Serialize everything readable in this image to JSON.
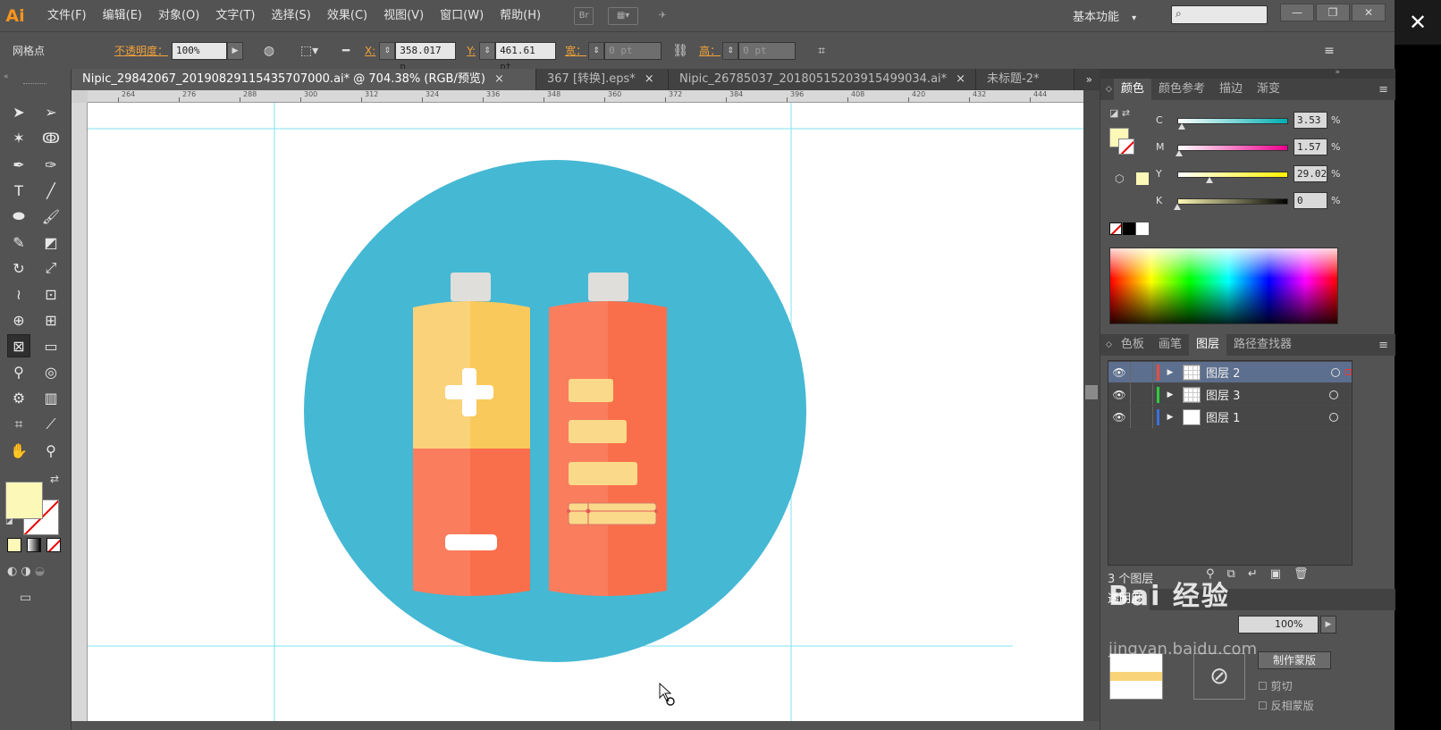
{
  "app": {
    "logo": "Ai"
  },
  "menu": [
    "文件(F)",
    "编辑(E)",
    "对象(O)",
    "文字(T)",
    "选择(S)",
    "效果(C)",
    "视图(V)",
    "窗口(W)",
    "帮助(H)"
  ],
  "workspace": {
    "label": "基本功能",
    "arrow": "▾"
  },
  "window_controls": {
    "minimize": "—",
    "restore": "❐",
    "close": "✕",
    "app_close": "✕"
  },
  "controlbar": {
    "selection_label": "网格点",
    "opacity_label": "不透明度：",
    "opacity_value": "100%",
    "x_label": "X:",
    "x_value": "358.017 p",
    "y_label": "Y:",
    "y_value": "461.61 pt",
    "w_label": "宽：",
    "w_value": "0 pt",
    "h_label": "高：",
    "h_value": "0 pt"
  },
  "tabs": [
    {
      "label": "Nipic_29842067_20190829115435707000.ai* @ 704.38% (RGB/预览)",
      "active": true,
      "close": "×"
    },
    {
      "label": "367 [转换].eps*",
      "active": false,
      "close": "×"
    },
    {
      "label": "Nipic_26785037_20180515203915499034.ai*",
      "active": false,
      "close": "×"
    },
    {
      "label": "未标题-2*",
      "active": false,
      "close": ""
    }
  ],
  "tab_overflow": "»",
  "ruler": {
    "ticks": [
      "264",
      "276",
      "288",
      "300",
      "312",
      "324",
      "336",
      "348",
      "360",
      "372",
      "384",
      "396",
      "408",
      "420",
      "432",
      "444"
    ]
  },
  "color_panel": {
    "tabs": [
      "颜色",
      "颜色参考",
      "描边",
      "渐变"
    ],
    "active_tab": 0,
    "sliders": [
      {
        "label": "C",
        "value": "3.53",
        "fraction": 0.04,
        "gradient": [
          "#ffffff",
          "#00aeb0"
        ]
      },
      {
        "label": "M",
        "value": "1.57",
        "fraction": 0.02,
        "gradient": [
          "#ffffff",
          "#ec008c"
        ]
      },
      {
        "label": "Y",
        "value": "29.02",
        "fraction": 0.29,
        "gradient": [
          "#ffffff",
          "#fff200"
        ]
      },
      {
        "label": "K",
        "value": "0",
        "fraction": 0.0,
        "gradient": [
          "#fbf7b4",
          "#000000"
        ]
      }
    ],
    "pct": "%",
    "fill_color": "#fbf8b8"
  },
  "layers_panel": {
    "tabs": [
      "色板",
      "画笔",
      "图层",
      "路径查找器"
    ],
    "active_tab": 2,
    "layers": [
      {
        "name": "图层 2",
        "color": "#e84c3d",
        "selected": true,
        "thumb": "grid"
      },
      {
        "name": "图层 3",
        "color": "#2ecc40",
        "selected": false,
        "thumb": "grid"
      },
      {
        "name": "图层 1",
        "color": "#3a6fe0",
        "selected": false,
        "thumb": "plain"
      }
    ],
    "count_label": "3 个图层"
  },
  "transparency_panel": {
    "title": "透明度",
    "opacity_value": "100%",
    "make_mask": "制作蒙版",
    "clip_label": "剪切",
    "invert_label": "反相蒙版"
  },
  "watermark": "Bai 经验",
  "watermark_url": "jingyan.baidu.com",
  "artwork_colors": {
    "circle": "#45b8d4",
    "battery_yellow": "#f9c95c",
    "battery_orange": "#fa6f4b",
    "cap": "#e0dedb",
    "bar": "#fbd98a"
  }
}
